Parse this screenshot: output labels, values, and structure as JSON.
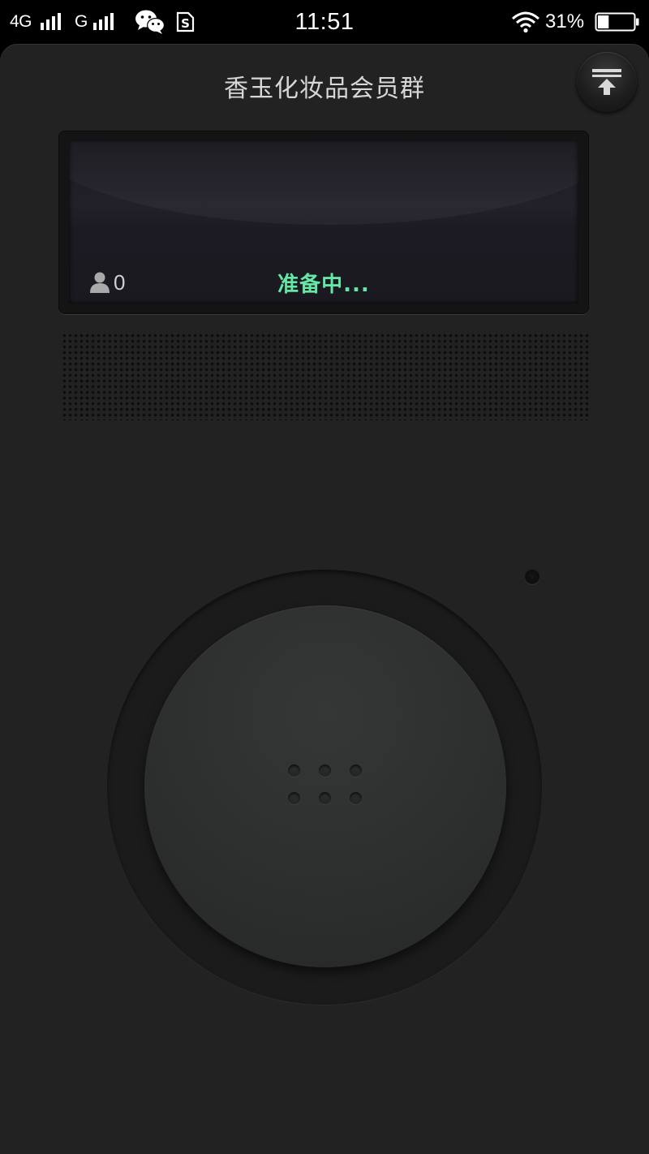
{
  "status_bar": {
    "network_1": "4G",
    "network_2": "G",
    "time": "11:51",
    "battery_percent": "31%",
    "battery_level": 0.31,
    "icons": [
      "signal-bars-icon",
      "signal-bars-icon",
      "wechat-icon",
      "sim-s-icon",
      "wifi-icon",
      "battery-icon"
    ]
  },
  "room": {
    "title": "香玉化妆品会员群"
  },
  "screen": {
    "member_count": "0",
    "status": "准备中..."
  },
  "colors": {
    "status_text": "#63e8a6",
    "panel": "#222222"
  },
  "icons": {
    "minimize": "collapse-up-arrow-icon",
    "member": "person-icon"
  }
}
